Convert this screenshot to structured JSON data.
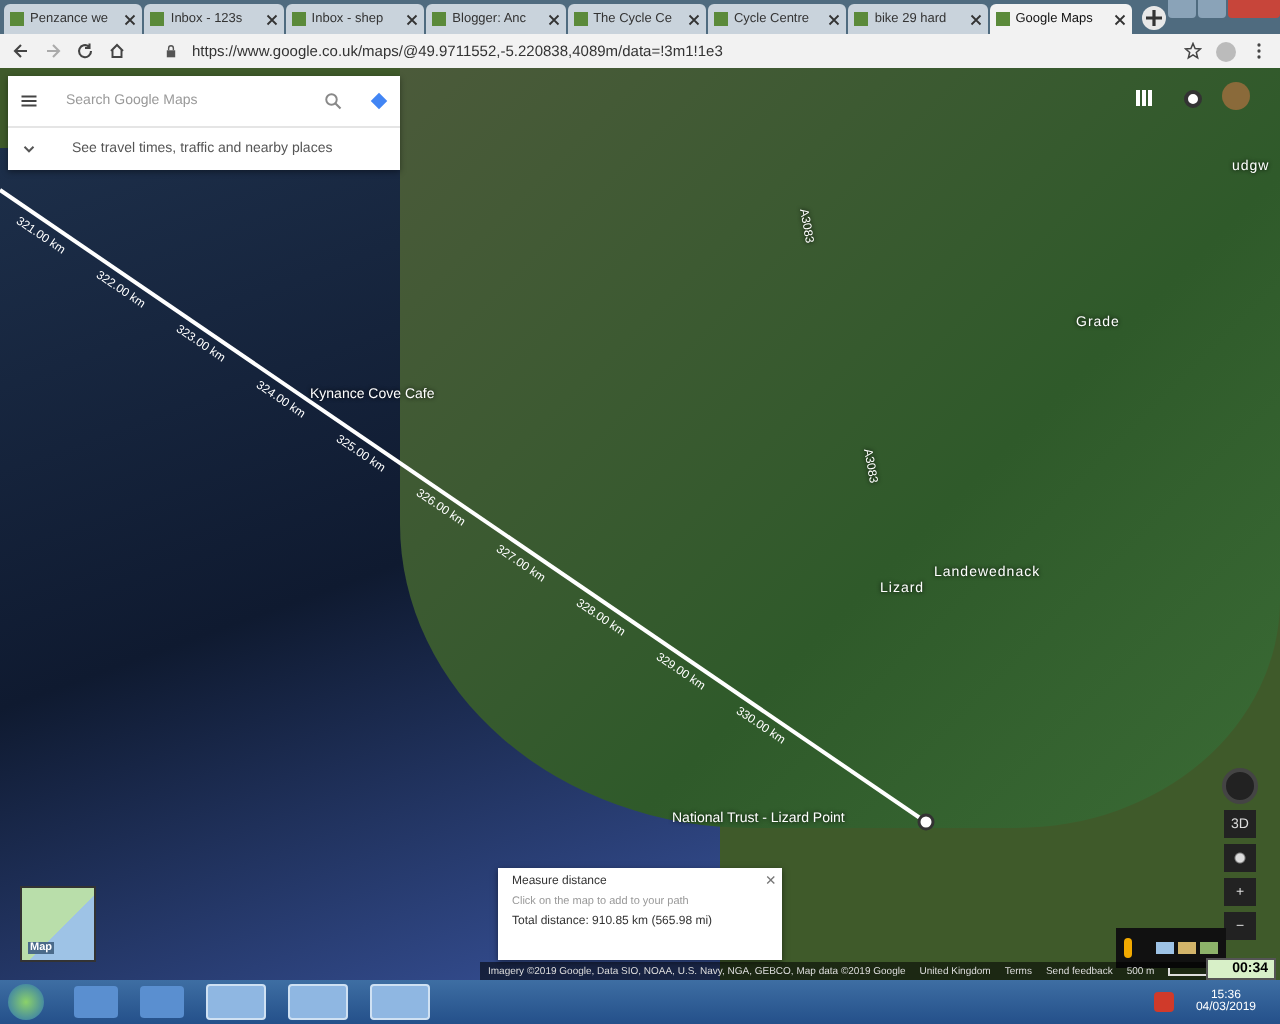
{
  "tabs": [
    {
      "label": "Penzance we",
      "selected": false
    },
    {
      "label": "Inbox - 123s",
      "selected": false
    },
    {
      "label": "Inbox - shep",
      "selected": false
    },
    {
      "label": "Blogger: Anc",
      "selected": false
    },
    {
      "label": "The Cycle Ce",
      "selected": false
    },
    {
      "label": "Cycle Centre",
      "selected": false
    },
    {
      "label": "bike 29 hard",
      "selected": false
    },
    {
      "label": "Google Maps",
      "selected": true
    }
  ],
  "address_bar": {
    "url": "https://www.google.co.uk/maps/@49.9711552,-5.220838,4089m/data=!3m1!1e3"
  },
  "search": {
    "placeholder": "Search Google Maps",
    "hint": "See travel times, traffic and nearby places"
  },
  "map_labels": [
    {
      "text": "Kynance Cove Cafe",
      "kind": "poi"
    },
    {
      "text": "Lizard",
      "kind": "place"
    },
    {
      "text": "Landewednack",
      "kind": "place"
    },
    {
      "text": "Grade",
      "kind": "place"
    },
    {
      "text": "udgw",
      "kind": "place"
    },
    {
      "text": "National Trust - Lizard Point",
      "kind": "poi"
    },
    {
      "text": "A3083",
      "kind": "road"
    },
    {
      "text": "A3083",
      "kind": "road"
    }
  ],
  "distance_labels": [
    "321.00 km",
    "322.00 km",
    "323.00 km",
    "324.00 km",
    "325.00 km",
    "326.00 km",
    "327.00 km",
    "328.00 km",
    "329.00 km",
    "330.00 km"
  ],
  "measure": {
    "title": "Measure distance",
    "hint": "Click on the map to add to your path",
    "total": "Total distance: 910.85 km (565.98 mi)",
    "close": "×"
  },
  "layer_switch": {
    "label": "Map"
  },
  "controls": {
    "tilt": "3D",
    "zoom_in": "+",
    "zoom_out": "−"
  },
  "footer": [
    "Imagery ©2019 Google, Data SIO, NOAA, U.S. Navy, NGA, GEBCO, Map data ©2019 Google",
    "United Kingdom",
    "Terms",
    "Send feedback"
  ],
  "scale": "500 m",
  "timer": "00:34",
  "clock": {
    "time": "15:36",
    "date": "04/03/2019"
  }
}
